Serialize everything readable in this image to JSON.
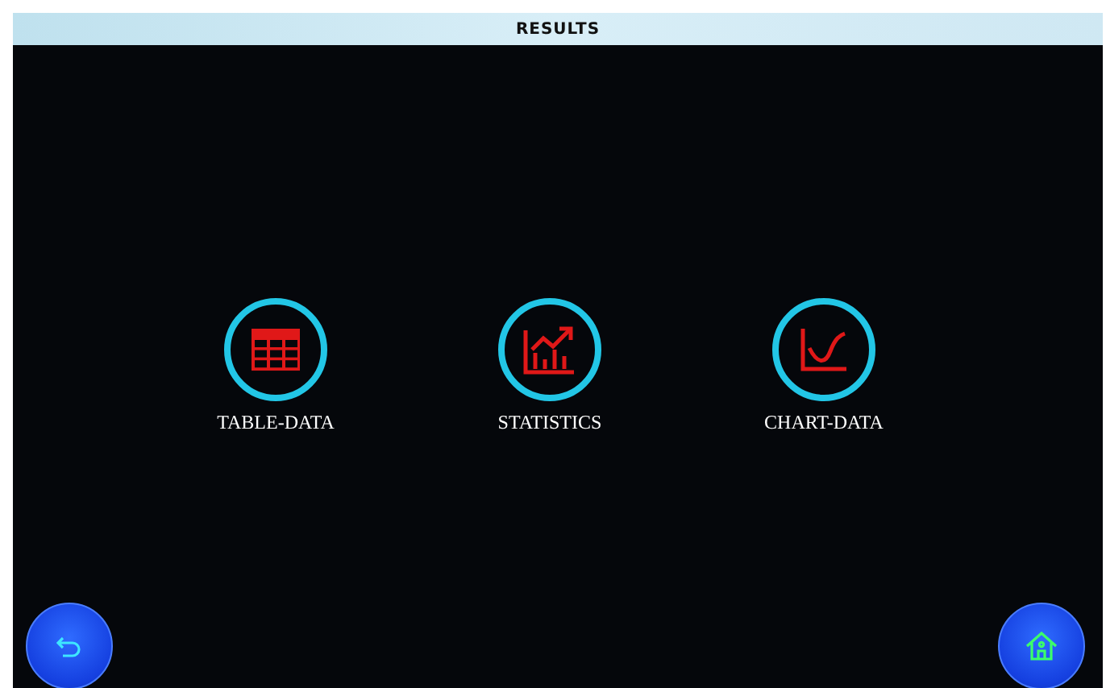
{
  "window": {
    "title": "RESULTS"
  },
  "menu_items": [
    {
      "kind": "table",
      "label": "TABLE-DATA"
    },
    {
      "kind": "statistics",
      "label": "STATISTICS"
    },
    {
      "kind": "chart",
      "label": "CHART-DATA"
    }
  ],
  "nav_buttons": [
    {
      "kind": "back"
    },
    {
      "kind": "home"
    }
  ]
}
